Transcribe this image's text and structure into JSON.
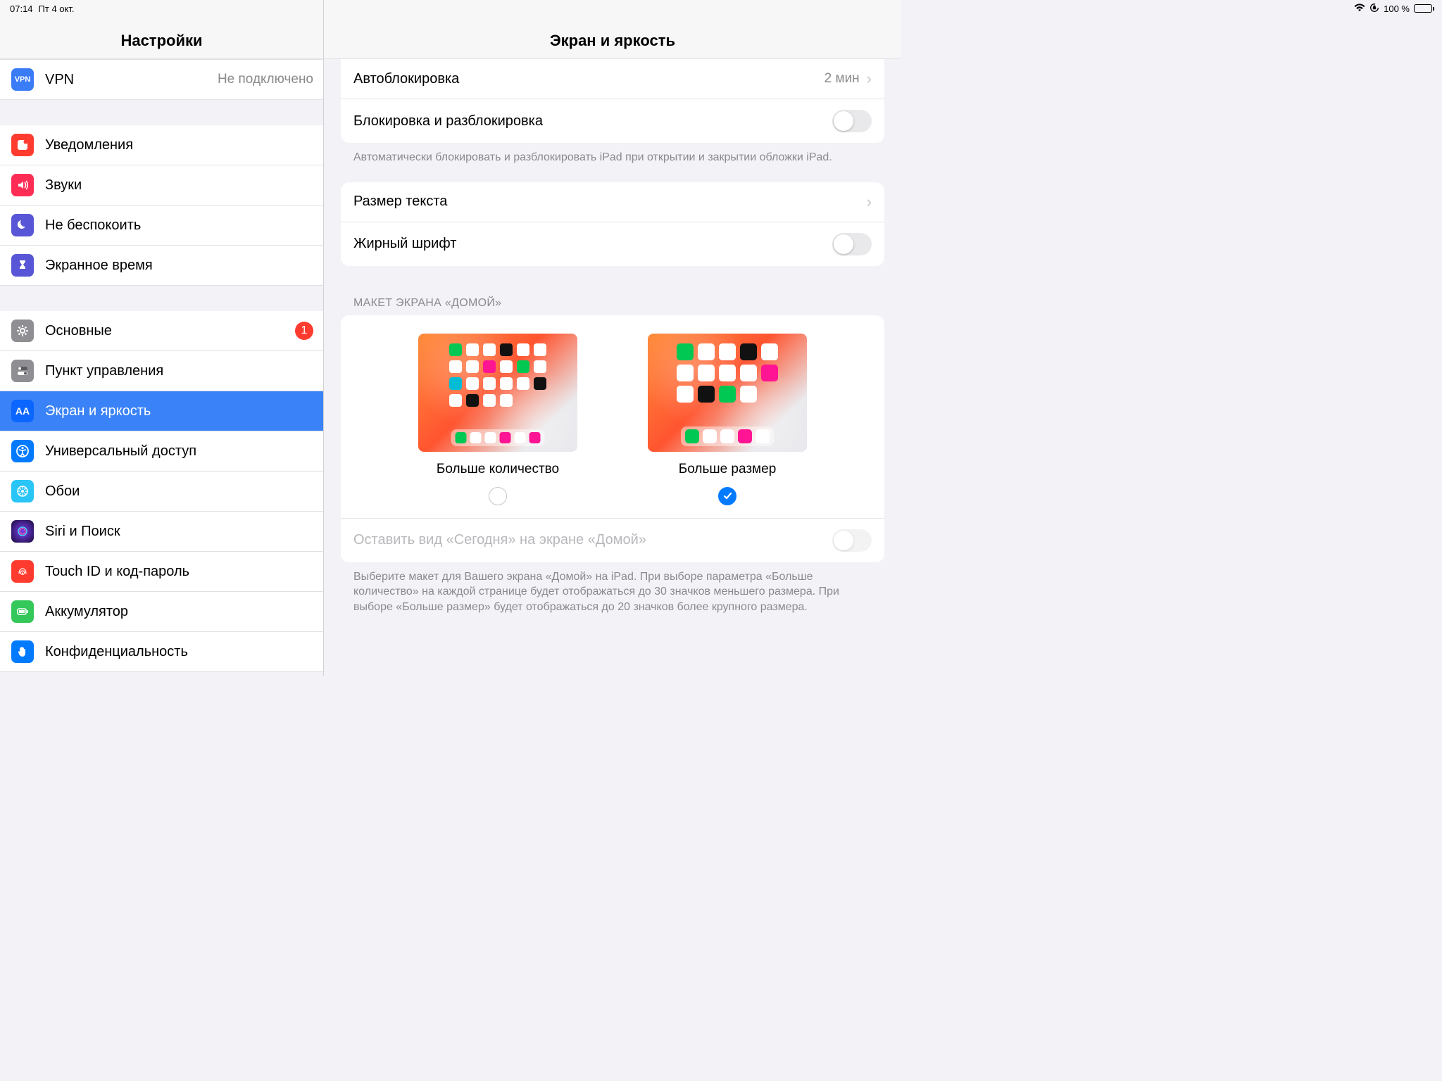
{
  "status": {
    "time": "07:14",
    "date": "Пт 4 окт.",
    "battery_pct": "100 %"
  },
  "sidebar": {
    "title": "Настройки",
    "vpn": {
      "label": "VPN",
      "value": "Не подключено"
    },
    "items1": [
      {
        "label": "Уведомления"
      },
      {
        "label": "Звуки"
      },
      {
        "label": "Не беспокоить"
      },
      {
        "label": "Экранное время"
      }
    ],
    "items2": [
      {
        "label": "Основные",
        "badge": "1"
      },
      {
        "label": "Пункт управления"
      },
      {
        "label": "Экран и яркость",
        "selected": true
      },
      {
        "label": "Универсальный доступ"
      },
      {
        "label": "Обои"
      },
      {
        "label": "Siri и Поиск"
      },
      {
        "label": "Touch ID и код-пароль"
      },
      {
        "label": "Аккумулятор"
      },
      {
        "label": "Конфиденциальность"
      }
    ]
  },
  "detail": {
    "title": "Экран и яркость",
    "autolock": {
      "label": "Автоблокировка",
      "value": "2 мин"
    },
    "lockunlock": {
      "label": "Блокировка и разблокировка"
    },
    "lockunlock_note": "Автоматически блокировать и разблокировать iPad при открытии и закрытии обложки iPad.",
    "textsize": {
      "label": "Размер текста"
    },
    "bold": {
      "label": "Жирный шрифт"
    },
    "home_header": "МАКЕТ ЭКРАНА «ДОМОЙ»",
    "opt_more": "Больше количество",
    "opt_big": "Больше размер",
    "today_row": "Оставить вид «Сегодня» на экране «Домой»",
    "home_note": "Выберите макет для Вашего экрана «Домой» на iPad. При выборе параметра «Больше количество» на каждой странице будет отображаться до 30 значков меньшего размера. При выборе «Больше размер» будет отображаться до 20 значков более крупного размера."
  }
}
